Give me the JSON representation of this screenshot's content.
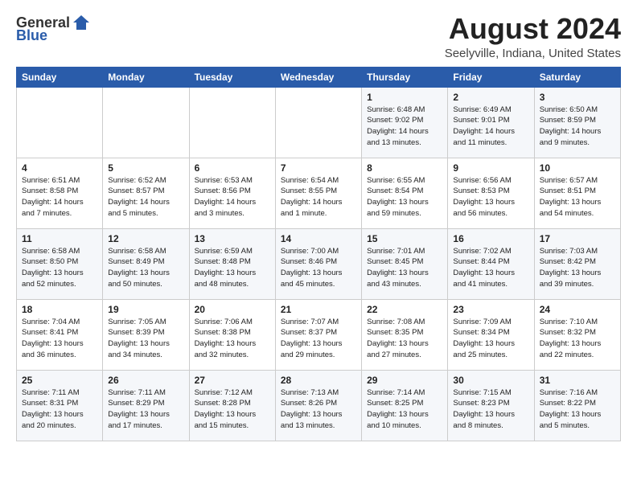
{
  "header": {
    "logo_general": "General",
    "logo_blue": "Blue",
    "month_title": "August 2024",
    "location": "Seelyville, Indiana, United States"
  },
  "days_of_week": [
    "Sunday",
    "Monday",
    "Tuesday",
    "Wednesday",
    "Thursday",
    "Friday",
    "Saturday"
  ],
  "weeks": [
    [
      {
        "day": "",
        "detail": ""
      },
      {
        "day": "",
        "detail": ""
      },
      {
        "day": "",
        "detail": ""
      },
      {
        "day": "",
        "detail": ""
      },
      {
        "day": "1",
        "detail": "Sunrise: 6:48 AM\nSunset: 9:02 PM\nDaylight: 14 hours\nand 13 minutes."
      },
      {
        "day": "2",
        "detail": "Sunrise: 6:49 AM\nSunset: 9:01 PM\nDaylight: 14 hours\nand 11 minutes."
      },
      {
        "day": "3",
        "detail": "Sunrise: 6:50 AM\nSunset: 8:59 PM\nDaylight: 14 hours\nand 9 minutes."
      }
    ],
    [
      {
        "day": "4",
        "detail": "Sunrise: 6:51 AM\nSunset: 8:58 PM\nDaylight: 14 hours\nand 7 minutes."
      },
      {
        "day": "5",
        "detail": "Sunrise: 6:52 AM\nSunset: 8:57 PM\nDaylight: 14 hours\nand 5 minutes."
      },
      {
        "day": "6",
        "detail": "Sunrise: 6:53 AM\nSunset: 8:56 PM\nDaylight: 14 hours\nand 3 minutes."
      },
      {
        "day": "7",
        "detail": "Sunrise: 6:54 AM\nSunset: 8:55 PM\nDaylight: 14 hours\nand 1 minute."
      },
      {
        "day": "8",
        "detail": "Sunrise: 6:55 AM\nSunset: 8:54 PM\nDaylight: 13 hours\nand 59 minutes."
      },
      {
        "day": "9",
        "detail": "Sunrise: 6:56 AM\nSunset: 8:53 PM\nDaylight: 13 hours\nand 56 minutes."
      },
      {
        "day": "10",
        "detail": "Sunrise: 6:57 AM\nSunset: 8:51 PM\nDaylight: 13 hours\nand 54 minutes."
      }
    ],
    [
      {
        "day": "11",
        "detail": "Sunrise: 6:58 AM\nSunset: 8:50 PM\nDaylight: 13 hours\nand 52 minutes."
      },
      {
        "day": "12",
        "detail": "Sunrise: 6:58 AM\nSunset: 8:49 PM\nDaylight: 13 hours\nand 50 minutes."
      },
      {
        "day": "13",
        "detail": "Sunrise: 6:59 AM\nSunset: 8:48 PM\nDaylight: 13 hours\nand 48 minutes."
      },
      {
        "day": "14",
        "detail": "Sunrise: 7:00 AM\nSunset: 8:46 PM\nDaylight: 13 hours\nand 45 minutes."
      },
      {
        "day": "15",
        "detail": "Sunrise: 7:01 AM\nSunset: 8:45 PM\nDaylight: 13 hours\nand 43 minutes."
      },
      {
        "day": "16",
        "detail": "Sunrise: 7:02 AM\nSunset: 8:44 PM\nDaylight: 13 hours\nand 41 minutes."
      },
      {
        "day": "17",
        "detail": "Sunrise: 7:03 AM\nSunset: 8:42 PM\nDaylight: 13 hours\nand 39 minutes."
      }
    ],
    [
      {
        "day": "18",
        "detail": "Sunrise: 7:04 AM\nSunset: 8:41 PM\nDaylight: 13 hours\nand 36 minutes."
      },
      {
        "day": "19",
        "detail": "Sunrise: 7:05 AM\nSunset: 8:39 PM\nDaylight: 13 hours\nand 34 minutes."
      },
      {
        "day": "20",
        "detail": "Sunrise: 7:06 AM\nSunset: 8:38 PM\nDaylight: 13 hours\nand 32 minutes."
      },
      {
        "day": "21",
        "detail": "Sunrise: 7:07 AM\nSunset: 8:37 PM\nDaylight: 13 hours\nand 29 minutes."
      },
      {
        "day": "22",
        "detail": "Sunrise: 7:08 AM\nSunset: 8:35 PM\nDaylight: 13 hours\nand 27 minutes."
      },
      {
        "day": "23",
        "detail": "Sunrise: 7:09 AM\nSunset: 8:34 PM\nDaylight: 13 hours\nand 25 minutes."
      },
      {
        "day": "24",
        "detail": "Sunrise: 7:10 AM\nSunset: 8:32 PM\nDaylight: 13 hours\nand 22 minutes."
      }
    ],
    [
      {
        "day": "25",
        "detail": "Sunrise: 7:11 AM\nSunset: 8:31 PM\nDaylight: 13 hours\nand 20 minutes."
      },
      {
        "day": "26",
        "detail": "Sunrise: 7:11 AM\nSunset: 8:29 PM\nDaylight: 13 hours\nand 17 minutes."
      },
      {
        "day": "27",
        "detail": "Sunrise: 7:12 AM\nSunset: 8:28 PM\nDaylight: 13 hours\nand 15 minutes."
      },
      {
        "day": "28",
        "detail": "Sunrise: 7:13 AM\nSunset: 8:26 PM\nDaylight: 13 hours\nand 13 minutes."
      },
      {
        "day": "29",
        "detail": "Sunrise: 7:14 AM\nSunset: 8:25 PM\nDaylight: 13 hours\nand 10 minutes."
      },
      {
        "day": "30",
        "detail": "Sunrise: 7:15 AM\nSunset: 8:23 PM\nDaylight: 13 hours\nand 8 minutes."
      },
      {
        "day": "31",
        "detail": "Sunrise: 7:16 AM\nSunset: 8:22 PM\nDaylight: 13 hours\nand 5 minutes."
      }
    ]
  ]
}
